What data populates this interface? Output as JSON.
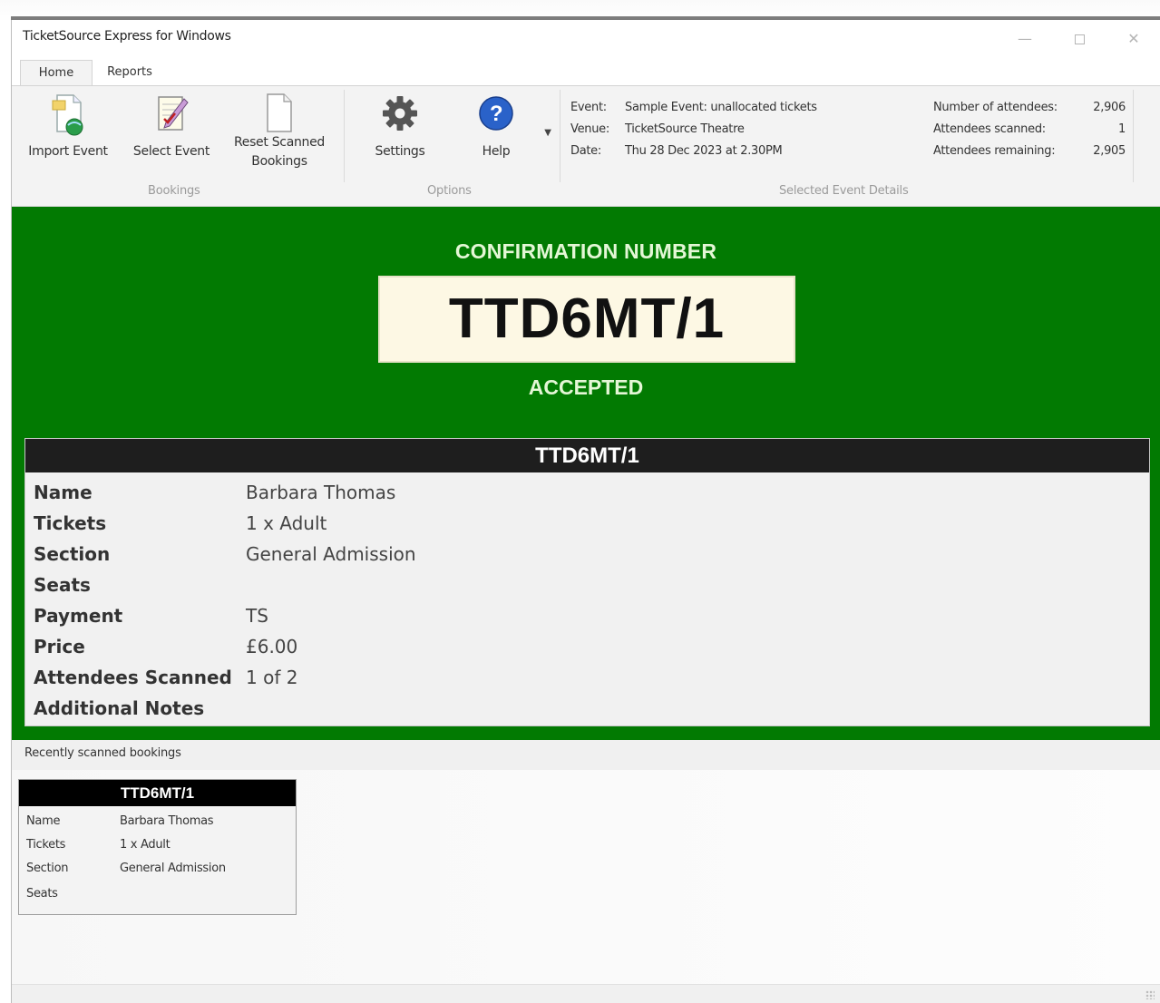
{
  "window": {
    "title": "TicketSource Express for Windows"
  },
  "tabs": [
    {
      "label": "Home"
    },
    {
      "label": "Reports"
    }
  ],
  "ribbon": {
    "import_event": "Import Event",
    "select_event": "Select Event",
    "reset_line1": "Reset Scanned",
    "reset_line2": "Bookings",
    "settings": "Settings",
    "help": "Help",
    "group_bookings": "Bookings",
    "group_options": "Options",
    "group_details": "Selected Event Details"
  },
  "event_details": {
    "event_label": "Event:",
    "event_value": "Sample Event: unallocated tickets",
    "venue_label": "Venue:",
    "venue_value": "TicketSource Theatre",
    "date_label": "Date:",
    "date_value": "Thu 28 Dec 2023 at 2.30PM"
  },
  "stats": {
    "attendees_label": "Number of attendees:",
    "attendees_value": "2,906",
    "scanned_label": "Attendees scanned:",
    "scanned_value": "1",
    "remaining_label": "Attendees remaining:",
    "remaining_value": "2,905"
  },
  "confirmation": {
    "label": "CONFIRMATION NUMBER",
    "number": "TTD6MT/1",
    "status": "ACCEPTED"
  },
  "booking": {
    "header": "TTD6MT/1",
    "fields": [
      {
        "key": "Name",
        "value": "Barbara Thomas"
      },
      {
        "key": "Tickets",
        "value": "1 x Adult"
      },
      {
        "key": "Section",
        "value": "General Admission"
      },
      {
        "key": "Seats",
        "value": ""
      },
      {
        "key": "Payment",
        "value": "TS"
      },
      {
        "key": "Price",
        "value": "£6.00"
      },
      {
        "key": "Attendees Scanned",
        "value": "1 of 2"
      },
      {
        "key": "Additional Notes",
        "value": ""
      }
    ]
  },
  "recent": {
    "label": "Recently scanned bookings",
    "cards": [
      {
        "header": "TTD6MT/1",
        "fields": [
          {
            "key": "Name",
            "value": "Barbara Thomas"
          },
          {
            "key": "Tickets",
            "value": "1 x Adult"
          },
          {
            "key": "Section",
            "value": "General Admission"
          },
          {
            "key": "Seats",
            "value": ""
          }
        ]
      }
    ]
  },
  "icons": {
    "import": "import-event-icon",
    "select": "select-event-icon",
    "reset": "document-icon",
    "settings": "gear-icon",
    "help": "help-icon"
  },
  "colors": {
    "accepted_green": "#027a02",
    "confirmation_box": "#fdf8e4",
    "header_dark": "#1e1e1e",
    "help_blue": "#2a62c9"
  }
}
